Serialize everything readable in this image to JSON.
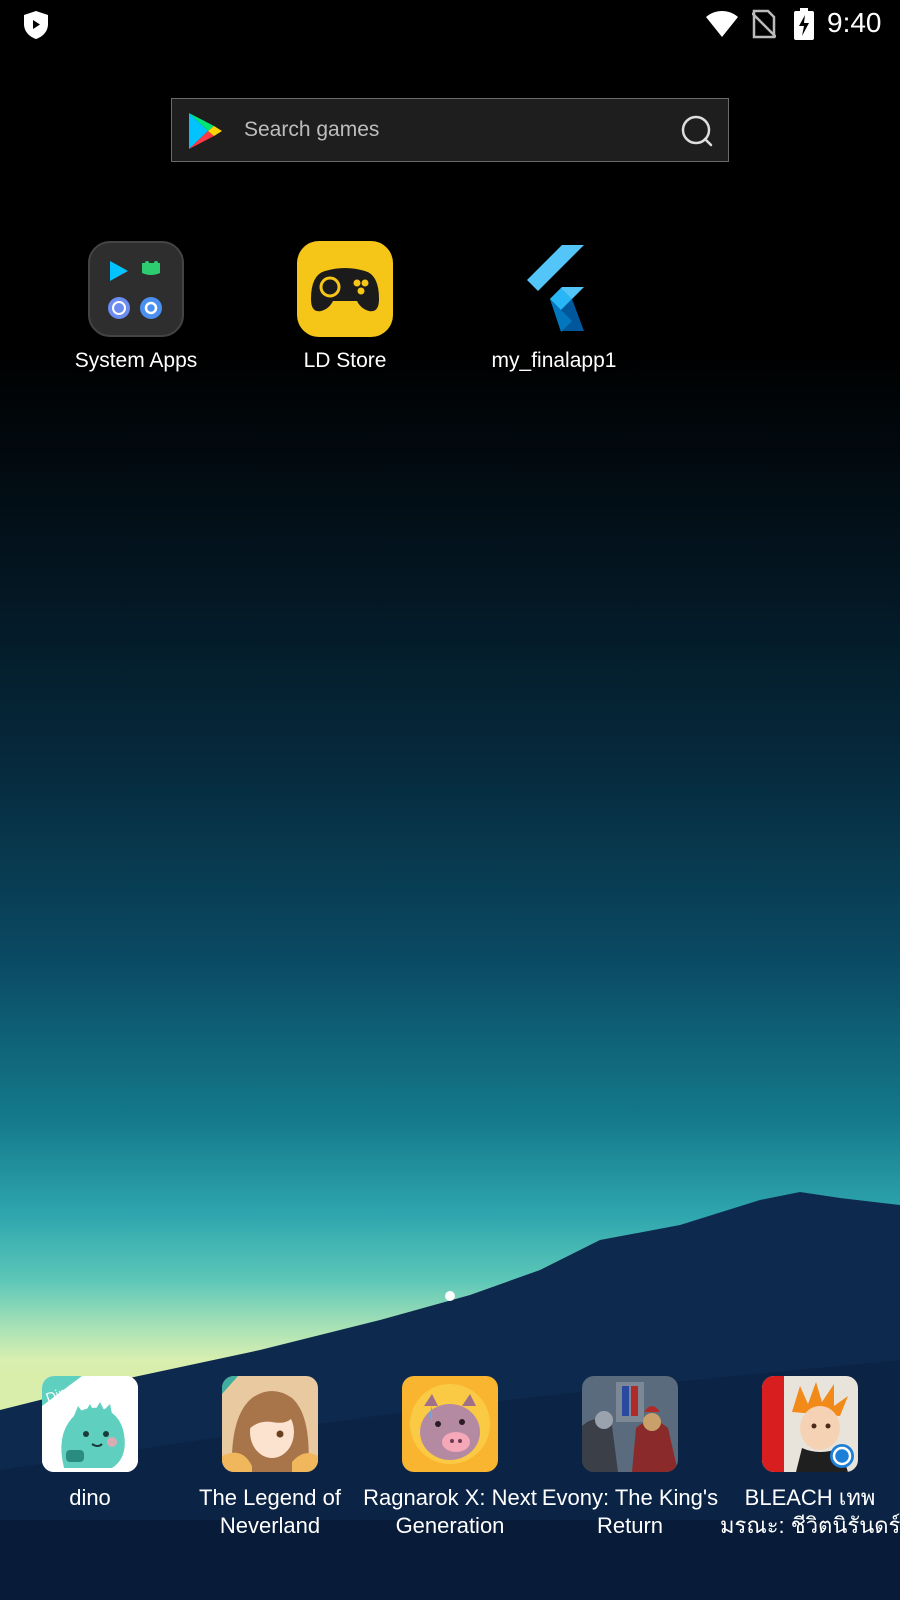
{
  "status_bar": {
    "time": "9:40",
    "icons": [
      "shield-icon",
      "wifi-icon",
      "no-sim-icon",
      "battery-charging-icon"
    ]
  },
  "search": {
    "placeholder": "Search games",
    "icon": "search-icon"
  },
  "home_apps": [
    {
      "label": "System Apps",
      "icon": "folder-icon"
    },
    {
      "label": "LD Store",
      "icon": "gamepad-icon"
    },
    {
      "label": "my_finalapp1",
      "icon": "flutter-icon"
    }
  ],
  "dock_apps": [
    {
      "line1": "dino",
      "line2": ""
    },
    {
      "line1": "The Legend of",
      "line2": "Neverland"
    },
    {
      "line1": "Ragnarok X: Next",
      "line2": "Generation"
    },
    {
      "line1": "Evony: The King's",
      "line2": "Return"
    },
    {
      "line1": "BLEACH เทพ",
      "line2": "มรณะ: ชีวิตนิรันดร์"
    }
  ],
  "colors": {
    "ld_store_yellow": "#f5c518",
    "flutter_blue": "#42a5f5",
    "dino_teal": "#5fd0c0"
  },
  "page_indicator": {
    "current": 1,
    "total": 1
  }
}
